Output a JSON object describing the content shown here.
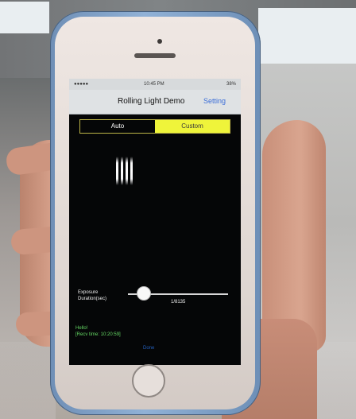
{
  "screen": {
    "status": {
      "carrier_signal": "●●●●● ",
      "time": "10:45 PM",
      "battery": "38%"
    },
    "nav": {
      "title": "Rolling Light Demo",
      "setting": "Setting"
    },
    "mode": {
      "auto": "Auto",
      "custom": "Custom"
    },
    "exposure": {
      "label_line_1": "Exposure",
      "label_line_2": "Duration(sec)",
      "value": "1/8135"
    },
    "message": {
      "line_1": "Hello!",
      "line_2": "[Recv time: 10:20:59]"
    },
    "done": "Done"
  },
  "colors": {
    "custom_active": "#eff43a",
    "setting_link": "#3b6ed8",
    "message_text": "#65d864",
    "done_link": "#245fbd"
  }
}
